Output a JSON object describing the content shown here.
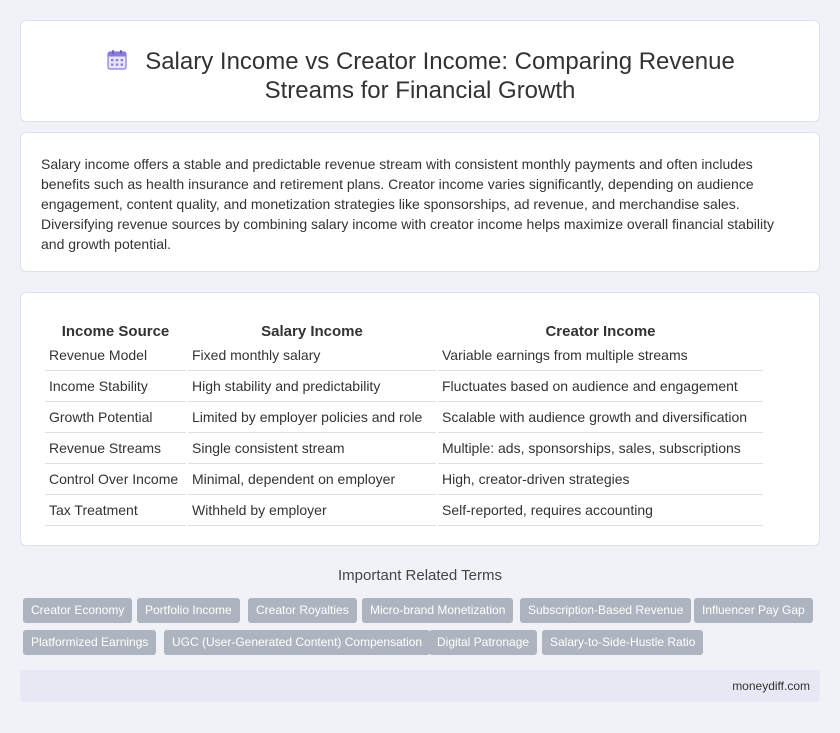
{
  "header": {
    "icon": "calendar-icon",
    "title": "Salary Income vs Creator Income: Comparing Revenue Streams for Financial Growth"
  },
  "summary": {
    "text": "Salary income offers a stable and predictable revenue stream with consistent monthly payments and often includes benefits such as health insurance and retirement plans. Creator income varies significantly, depending on audience engagement, content quality, and monetization strategies like sponsorships, ad revenue, and merchandise sales. Diversifying revenue sources by combining salary income with creator income helps maximize overall financial stability and growth potential."
  },
  "table": {
    "headers": [
      "Income Source",
      "Salary Income",
      "Creator Income"
    ],
    "rows": [
      [
        "Revenue Model",
        "Fixed monthly salary",
        "Variable earnings from multiple streams"
      ],
      [
        "Income Stability",
        "High stability and predictability",
        "Fluctuates based on audience and engagement"
      ],
      [
        "Growth Potential",
        "Limited by employer policies and role",
        "Scalable with audience growth and diversification"
      ],
      [
        "Revenue Streams",
        "Single consistent stream",
        "Multiple: ads, sponsorships, sales, subscriptions"
      ],
      [
        "Control Over Income",
        "Minimal, dependent on employer",
        "High, creator-driven strategies"
      ],
      [
        "Tax Treatment",
        "Withheld by employer",
        "Self-reported, requires accounting"
      ]
    ]
  },
  "related": {
    "title": "Important Related Terms",
    "tags": [
      "Creator Economy",
      "Portfolio Income",
      "Creator Royalties",
      "Micro-brand Monetization",
      "Subscription-Based Revenue",
      "Influencer Pay Gap",
      "Platformized Earnings",
      "UGC (User-Generated Content) Compensation",
      "Digital Patronage",
      "Salary-to-Side-Hustle Ratio"
    ]
  },
  "footer": {
    "site": "moneydiff.com"
  },
  "colors": {
    "page_bg": "#f0f2f7",
    "tag_bg": "#aeb4bf",
    "footer_bg": "#e6e9f4",
    "icon_accent": "#8a7bd8"
  }
}
